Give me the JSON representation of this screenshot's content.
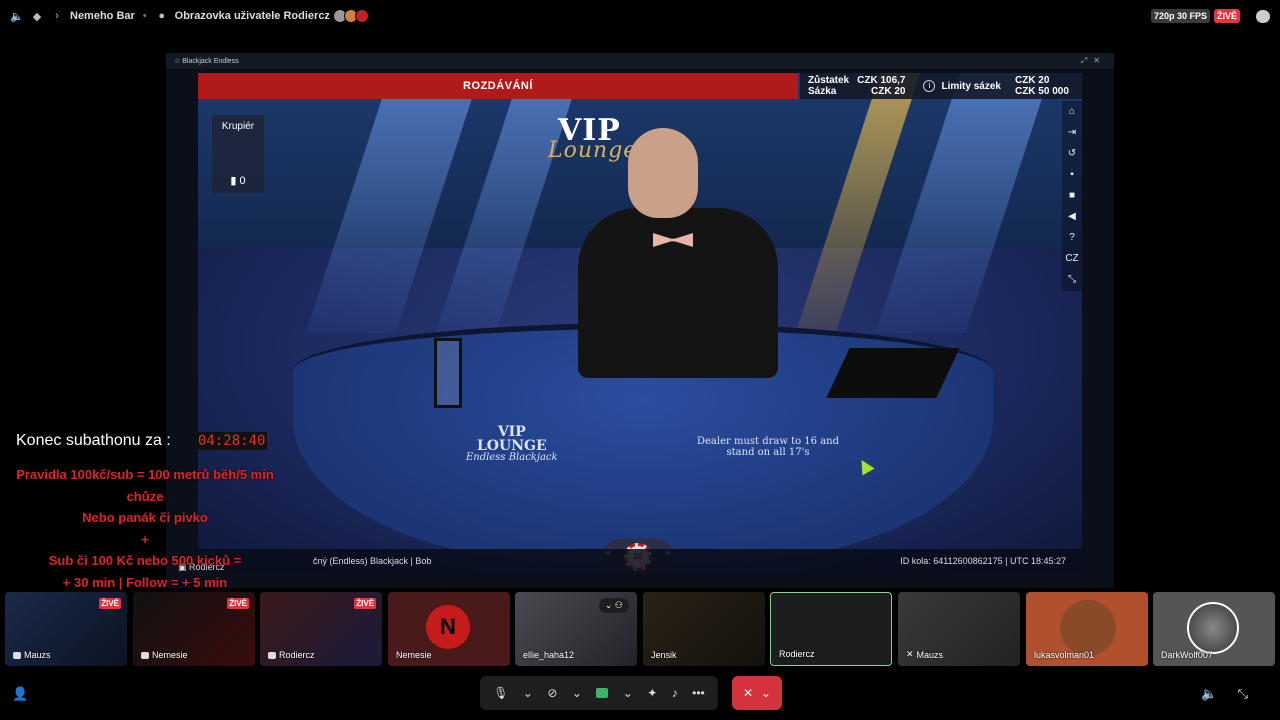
{
  "topbar": {
    "server": "Nemeho Bar",
    "screen_title": "Obrazovka uživatele Rodiercz",
    "quality": "720p 30 FPS",
    "live": "ŽIVĚ"
  },
  "game": {
    "window_title": "Blackjack Endless",
    "status": "ROZDÁVÁNÍ",
    "balance_label": "Zůstatek",
    "balance_value": "CZK 106,7",
    "bet_label": "Sázka",
    "bet_value": "CZK 20",
    "limits_label": "Limity sázek",
    "limit_min": "CZK 20",
    "limit_max": "CZK 50 000",
    "dealer_label": "Krupiér",
    "card_count": "0",
    "sidebar_lang": "CZ",
    "table_logo_line1": "VIP",
    "table_logo_line2": "LOUNGE",
    "table_logo_line3": "Endless Blackjack",
    "table_rule": "Dealer must draw to 16 and stand on all 17's",
    "chip_value": "20",
    "footer_left": "čný (Endless) Blackjack | Bob",
    "footer_round": "ID kola: 64112600862175 | UTC 18:45:27",
    "user_tag": "Rodiercz"
  },
  "overlay": {
    "sub_label": "Konec subathonu za :",
    "timer": "04:28:40",
    "rule1": "Pravidla 100kč/sub = 100 metrů běh/5 min chůze",
    "rule2": "Nebo panák či pivko",
    "rule3": "+",
    "rule4": "Sub či 100 Kč nebo 500 kicků =",
    "rule5": "+ 30 min | Follow = + 5 min"
  },
  "participants": [
    {
      "name": "Mauzs",
      "live": "ŽIVĚ"
    },
    {
      "name": "Nemesie",
      "live": "ŽIVĚ"
    },
    {
      "name": "Rodiercz",
      "live": "ŽIVĚ"
    },
    {
      "name": "Nemesie"
    },
    {
      "name": "ellie_haha12"
    },
    {
      "name": "Jensik"
    },
    {
      "name": "Rodiercz"
    },
    {
      "name": "Mauzs"
    },
    {
      "name": "lukasvolman01"
    },
    {
      "name": "DarkWolf007"
    }
  ]
}
